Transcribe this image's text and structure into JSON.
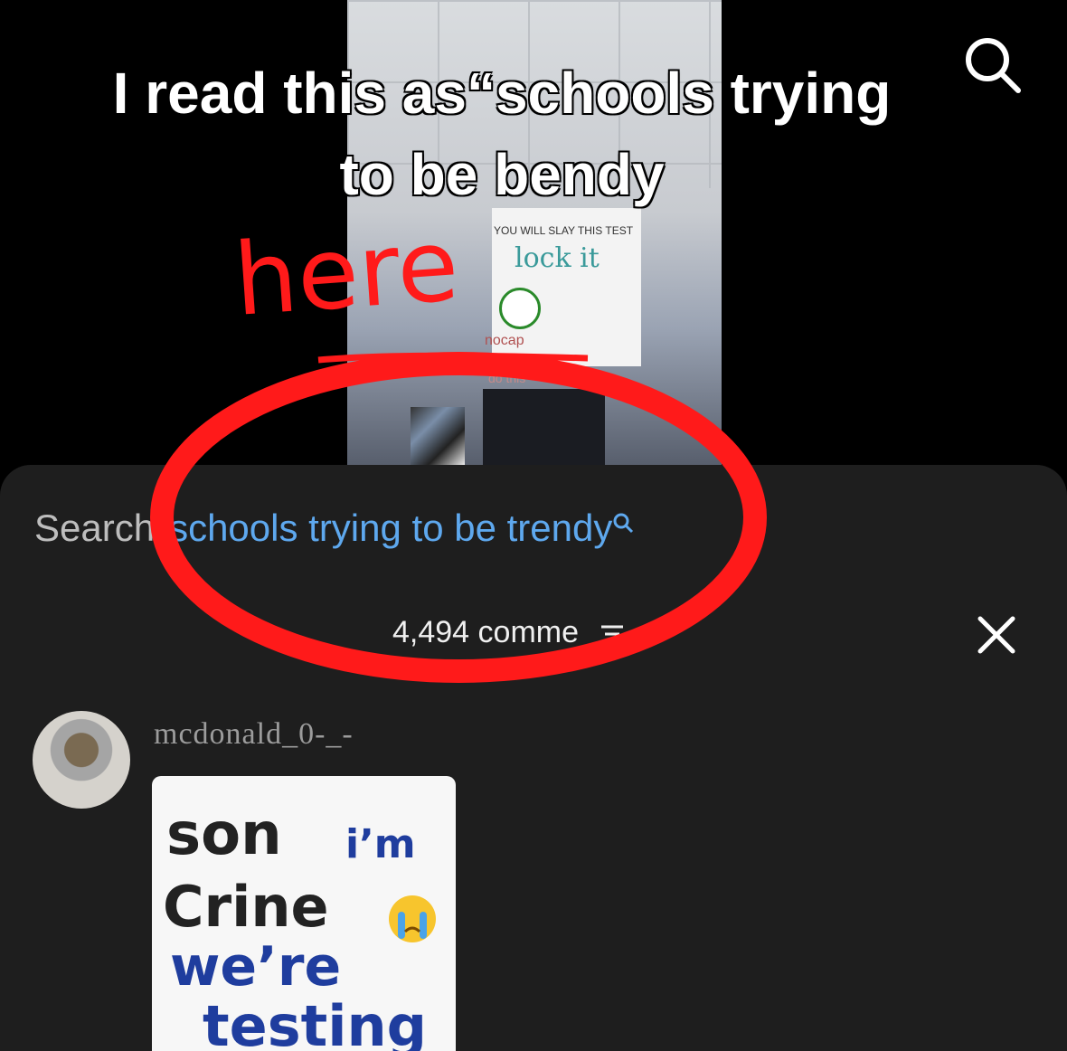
{
  "video": {
    "board_line1": "YOU WILL SLAY THIS TEST",
    "board_line2": "lock it",
    "board_line3": "nocap",
    "board_line4": "do this"
  },
  "caption": {
    "line1": "I read this as“schools trying",
    "line2": "to be bendy"
  },
  "annotation": {
    "handwritten": "here",
    "color": "#ff0000"
  },
  "comments_panel": {
    "search_label": "Search",
    "search_query": "schools trying to be trendy",
    "count": "4,494 comme",
    "accent": "#5ea8ee"
  },
  "comment": {
    "username": "mcdonald_0-_-",
    "sign_line1": "son",
    "sign_line1b": "i’m",
    "sign_line2": "Crine",
    "sign_line3": "we’re",
    "sign_line4": "testing"
  },
  "icons": [
    "search-icon",
    "close-icon",
    "filter-icon",
    "emoji-crying-icon"
  ]
}
